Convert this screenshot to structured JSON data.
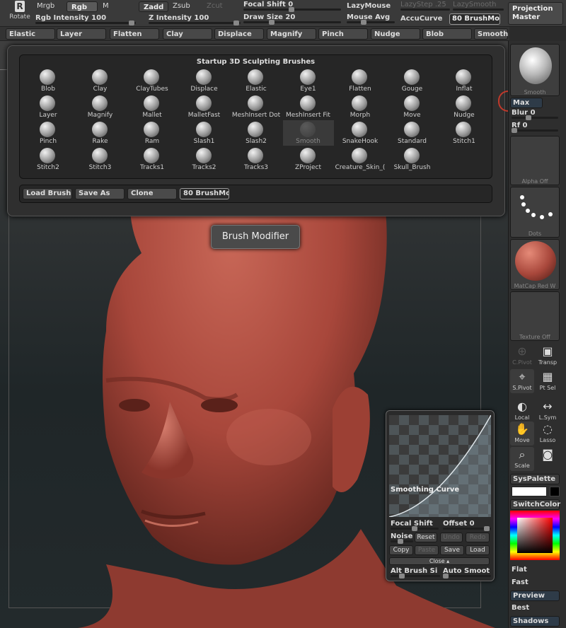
{
  "toolbar": {
    "rotate_label": "Rotate",
    "mrgb": "Mrgb",
    "rgb": "Rgb",
    "m": "M",
    "rgb_intensity": "Rgb Intensity 100",
    "zadd": "Zadd",
    "zsub": "Zsub",
    "zcut": "Zcut",
    "z_intensity": "Z Intensity 100",
    "focal_shift": "Focal Shift 0",
    "draw_size": "Draw Size 20",
    "lazymouse": "LazyMouse",
    "mouse_avg": "Mouse Avg",
    "lazystep": "LazyStep .25",
    "lazysmooth": "LazySmooth",
    "accucurve": "AccuCurve",
    "brushmod": "80 BrushMod",
    "projection_master": [
      "Projection",
      "Master"
    ]
  },
  "brush_bar": [
    "Elastic",
    "Layer",
    "Flatten",
    "Clay",
    "Displace",
    "Magnify",
    "Pinch",
    "Nudge",
    "Blob",
    "Smooth"
  ],
  "palette": {
    "title": "Startup 3D Sculpting Brushes",
    "brushes": [
      "Blob",
      "Clay",
      "ClayTubes",
      "Displace",
      "Elastic",
      "Eye1",
      "Flatten",
      "Gouge",
      "Inflat",
      "Layer",
      "Magnify",
      "Mallet",
      "MalletFast",
      "MeshInsert Dot",
      "MeshInsert Fit",
      "Morph",
      "Move",
      "Nudge",
      "Pinch",
      "Rake",
      "Ram",
      "Slash1",
      "Slash2",
      "Smooth",
      "SnakeHook",
      "Standard",
      "Stitch1",
      "Stitch2",
      "Stitch3",
      "Tracks1",
      "Tracks2",
      "Tracks3",
      "ZProject",
      "Creature_Skin_(",
      "Skull_Brush"
    ],
    "selected": "Smooth",
    "buttons": {
      "load": "Load Brush",
      "save": "Save As",
      "clone": "Clone",
      "modifier": "80 BrushMod"
    }
  },
  "tooltip": "Brush Modifier",
  "tray": {
    "smooth_thumb": "Smooth",
    "max": "Max",
    "blur": "Blur 0",
    "rf": "Rf 0",
    "alpha": "Alpha  Off",
    "dots": "Dots",
    "matcap": "MatCap  Red  W",
    "texture": "Texture  Off",
    "cpivot": "C.Pivot",
    "transp": "Transp",
    "spivot": "S.Pivot",
    "ptsel": "Pt Sel",
    "local": "Local",
    "lsym": "L.Sym",
    "move": "Move",
    "lasso": "Lasso",
    "scale": "Scale",
    "syspalette": "SysPalette",
    "switchcolor": "SwitchColor",
    "flat": "Flat",
    "fast": "Fast",
    "preview": "Preview",
    "best": "Best",
    "shadows": "Shadows"
  },
  "curve_panel": {
    "label": "Smoothing Curve",
    "focal_shift": "Focal Shift",
    "offset": "Offset 0",
    "noise": "Noise",
    "reset": "Reset",
    "undo": "Undo",
    "redo": "Redo",
    "copy": "Copy",
    "paste": "Paste",
    "save": "Save",
    "load": "Load",
    "close": "Close",
    "alt_brush": "Alt Brush Si",
    "auto_smooth": "Auto Smoot"
  },
  "colors": {
    "skin": "#a8473b",
    "accent_red": "#c0392b"
  }
}
